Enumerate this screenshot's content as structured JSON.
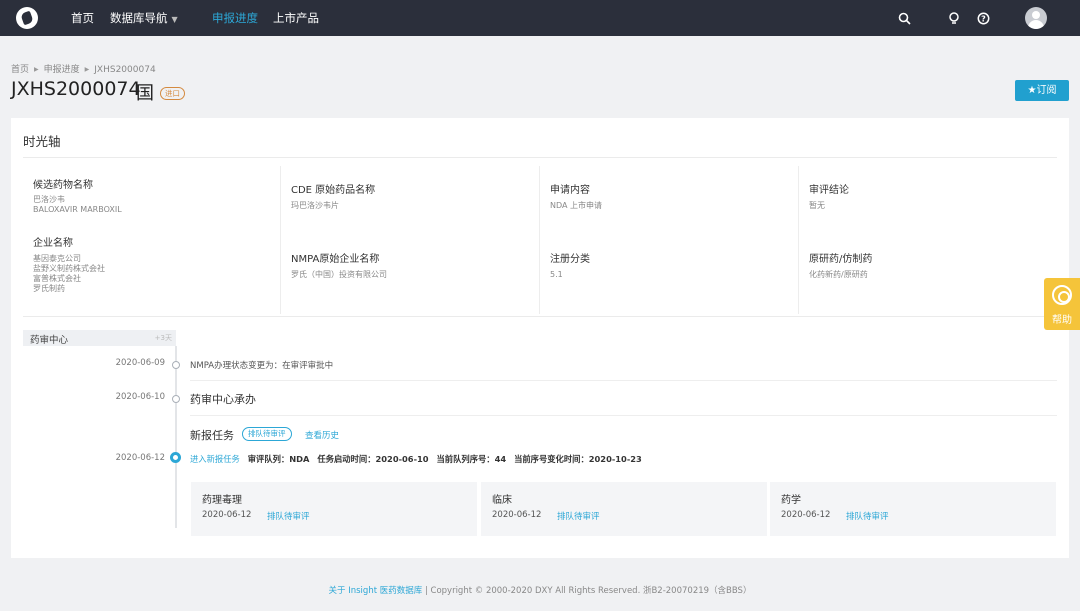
{
  "nav": {
    "home": "首页",
    "database_nav": "数据库导航",
    "progress": "申报进度",
    "products": "上市产品"
  },
  "icons": {
    "search": "search-icon",
    "lightbulb": "lightbulb-icon",
    "help": "help-circle-icon",
    "avatar": "user-avatar"
  },
  "breadcrumb": [
    "首页",
    "申报进度",
    "JXHS2000074"
  ],
  "header": {
    "title": "JXHS2000074",
    "country": "国",
    "badge": "进口",
    "subscribe": "★订阅"
  },
  "card": {
    "title": "时光轴",
    "info": {
      "drug_name_label": "候选药物名称",
      "drug_name_cn": "巴洛沙韦",
      "drug_name_en": "BALOXAVIR MARBOXIL",
      "company_label": "企业名称",
      "companies": [
        "基因泰克公司",
        "盐野义制药株式会社",
        "富普株式会社",
        "罗氏制药"
      ],
      "cde_label": "CDE 原始药品名称",
      "cde_value": "玛巴洛沙韦片",
      "nmpa_label": "NMPA原始企业名称",
      "nmpa_value": "罗氏（中国）投资有限公司",
      "apply_label": "申请内容",
      "apply_value": "NDA  上市申请",
      "reg_label": "注册分类",
      "reg_value": "5.1",
      "review_label": "审评结论",
      "review_value": "暂无",
      "orig_label": "原研药/仿制药",
      "orig_value": "化药新药/原研药"
    }
  },
  "timeline": {
    "phase": "药审中心",
    "duration": "+3天",
    "events": [
      {
        "date": "2020-06-09",
        "text": "NMPA办理状态变更为：在审评审批中"
      },
      {
        "date": "2020-06-10",
        "text": "药审中心承办"
      },
      {
        "date": "2020-06-12",
        "task_title": "新报任务",
        "status": "排队待审评",
        "history": "查看历史",
        "entry": "进入新报任务"
      }
    ],
    "detail": {
      "queue_label": "审评队列：",
      "queue": "NDA",
      "start_label": "任务启动时间：",
      "start": "2020-06-10",
      "seq_label": "当前队列序号：",
      "seq": "44",
      "change_label": "当前序号变化时间：",
      "change": "2020-10-23"
    },
    "panels": [
      {
        "title": "药理毒理",
        "date": "2020-06-12",
        "status": "排队待审评"
      },
      {
        "title": "临床",
        "date": "2020-06-12",
        "status": "排队待审评"
      },
      {
        "title": "药学",
        "date": "2020-06-12",
        "status": "排队待审评"
      }
    ]
  },
  "help_label": "帮助",
  "footer": {
    "about": "关于 Insight 医药数据库",
    "copyright": " | Copyright © 2000-2020 DXY All Rights Reserved. 浙B2-20070219（含BBS）"
  },
  "colors": {
    "nav_bg": "#2b2f3b",
    "accent": "#2ca7d6",
    "badge": "#d48a3f",
    "help": "#f5c43a"
  }
}
